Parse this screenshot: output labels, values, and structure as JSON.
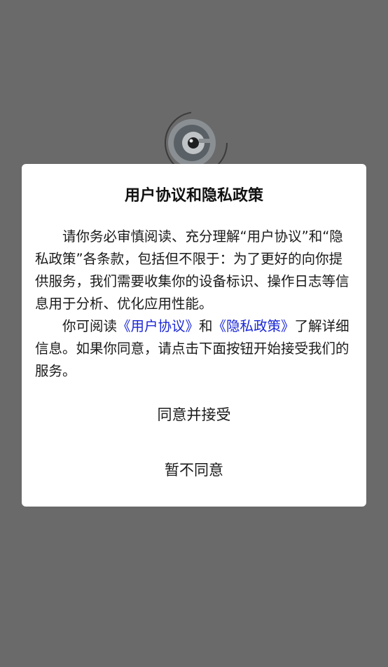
{
  "dialog": {
    "title": "用户协议和隐私政策",
    "paragraph1": "请你务必审慎阅读、充分理解“用户协议”和“隐私政策”各条款，包括但不限于：为了更好的向你提供服务，我们需要收集你的设备标识、操作日志等信息用于分析、优化应用性能。",
    "paragraph2_prefix": "你可阅读",
    "link_user_agreement": "《用户协议》",
    "paragraph2_and": "和",
    "link_privacy_policy": "《隐私政策》",
    "paragraph2_suffix": "了解详细信息。如果你同意，请点击下面按钮开始接受我们的服务。",
    "accept_label": "同意并接受",
    "decline_label": "暂不同意"
  },
  "colors": {
    "overlay": "#6a6a6a",
    "link": "#1a26d6",
    "dialog_bg": "#ffffff"
  },
  "icons": {
    "app_logo": "camera-lens-logo-icon"
  }
}
